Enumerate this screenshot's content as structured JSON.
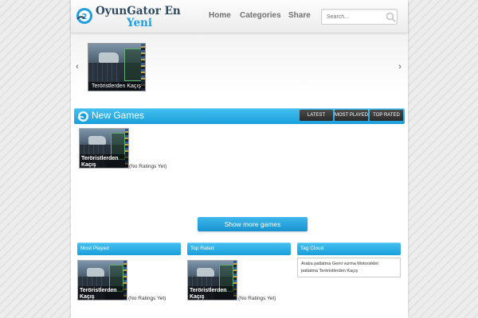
{
  "header": {
    "logo_line1": "OyunGator En",
    "logo_line2": "Yeni",
    "nav": [
      {
        "label": "Home"
      },
      {
        "label": "Categories"
      },
      {
        "label": "Share"
      }
    ],
    "search_placeholder": "Search..."
  },
  "slider": {
    "items": [
      {
        "caption": "Teröristlerden Kaçış"
      }
    ]
  },
  "new_games": {
    "title": "New Games",
    "tabs": [
      {
        "label": "LATEST"
      },
      {
        "label": "MOST PLAYED"
      },
      {
        "label": "TOP RATED"
      }
    ],
    "items": [
      {
        "title": "Teröristlerden Kaçış",
        "rating": "(No Ratings Yet)"
      }
    ],
    "show_more_label": "Show more games"
  },
  "columns": {
    "most_played": {
      "title": "Most Played",
      "items": [
        {
          "title": "Teröristlerden Kaçış",
          "rating": "(No Ratings Yet)"
        }
      ]
    },
    "top_rated": {
      "title": "Top Rated",
      "items": [
        {
          "title": "Teröristlerden Kaçış",
          "rating": "(No Ratings Yet)"
        }
      ]
    },
    "tag_cloud": {
      "title": "Tag Cloud",
      "tags_line1": "Araba patlatma Gemi vurma Motorsiklet",
      "tags_line2": "patlatma Teröristlerden Kaçış"
    }
  },
  "colors": {
    "accent": "#1a9fd9",
    "logo_dark": "#2f4a62",
    "logo_blue": "#1f9ee0"
  }
}
